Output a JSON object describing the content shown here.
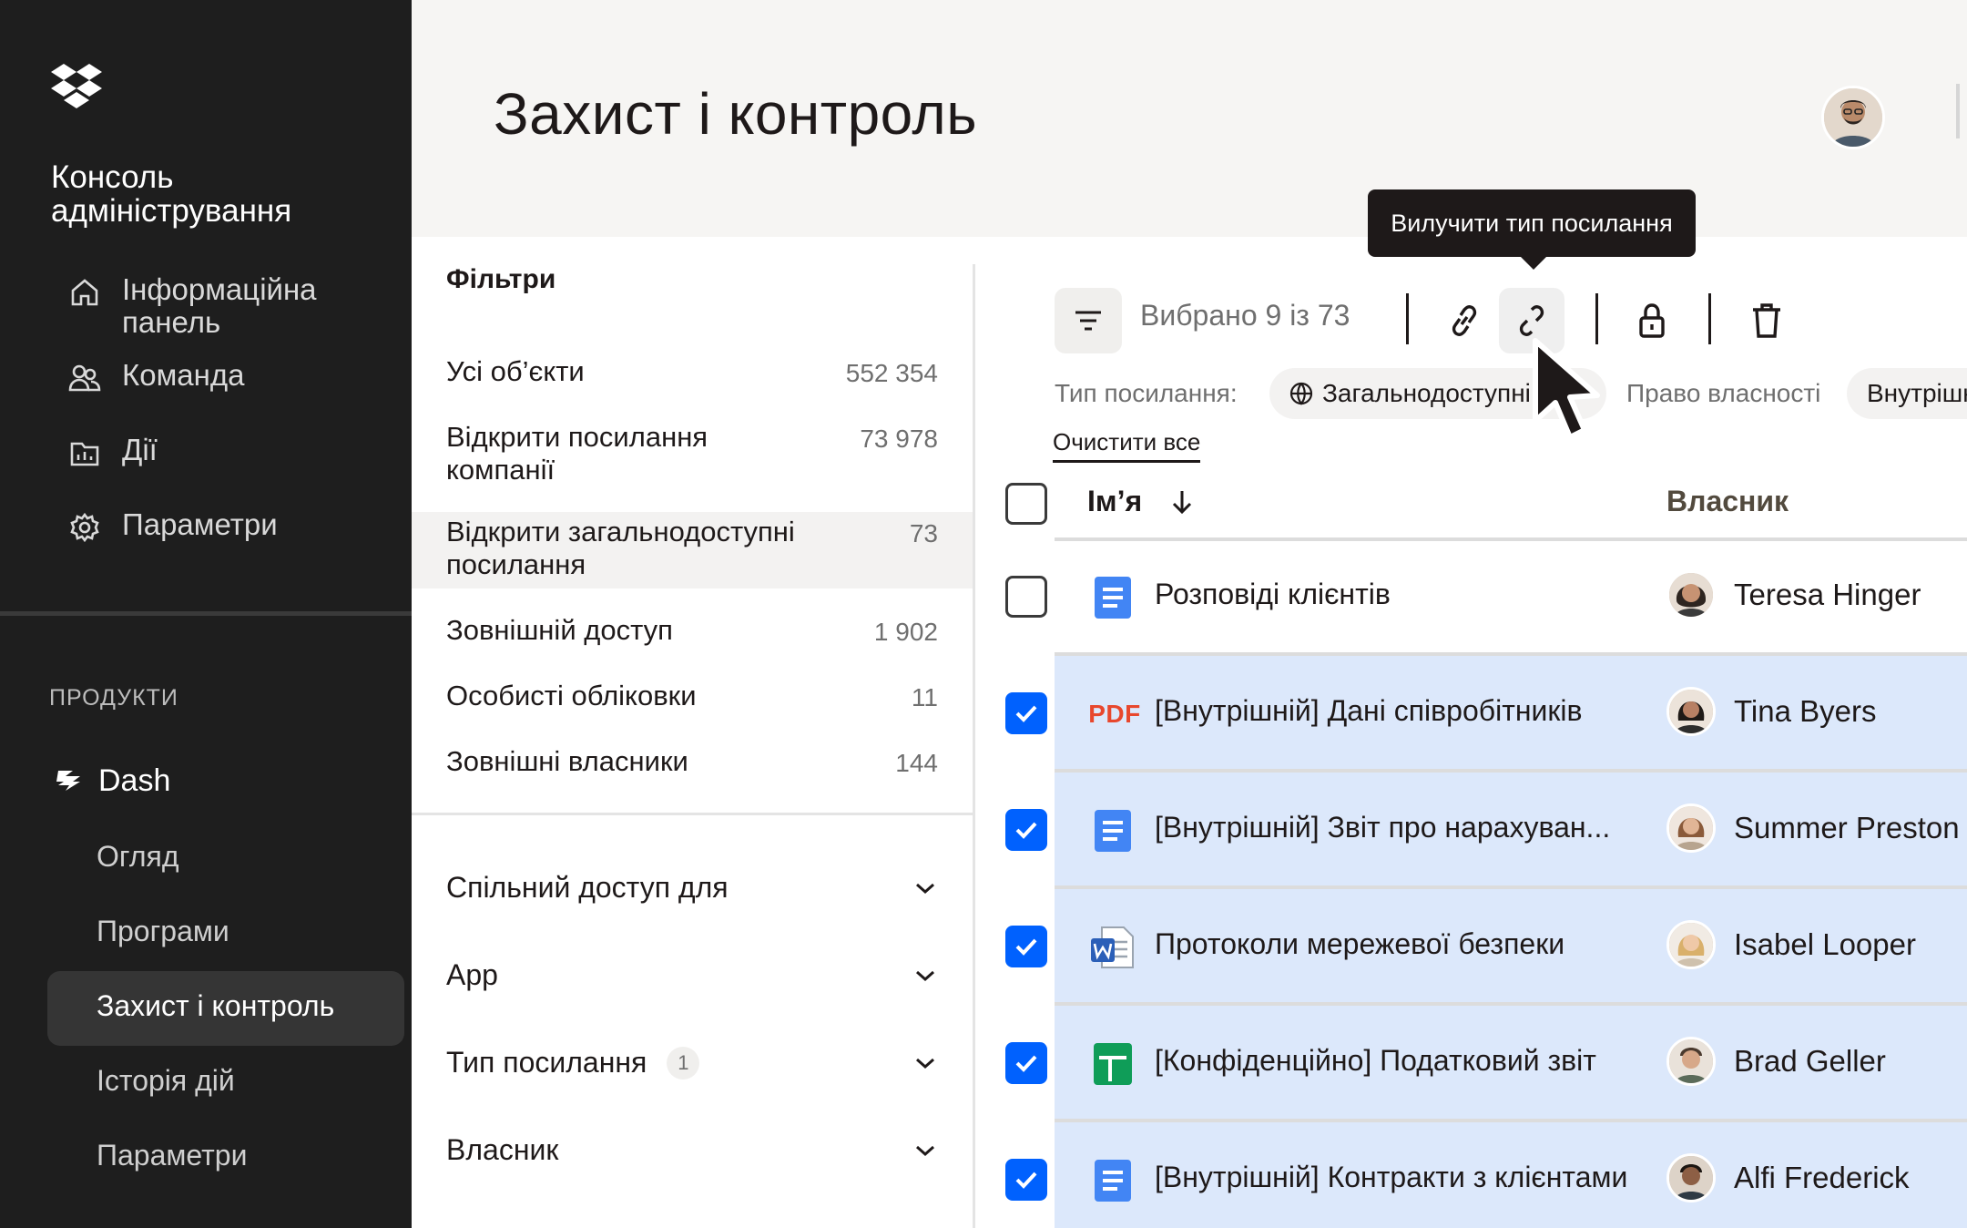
{
  "sidebar": {
    "logo": "dropbox-logo",
    "console_title": "Консоль адміністрування",
    "nav": [
      {
        "label": "Інформаційна панель",
        "icon": "home-icon"
      },
      {
        "label": "Команда",
        "icon": "team-icon"
      },
      {
        "label": "Дії",
        "icon": "activity-icon"
      },
      {
        "label": "Параметри",
        "icon": "gear-icon"
      }
    ],
    "products_label": "ПРОДУКТИ",
    "product": {
      "label": "Dash",
      "icon": "dash-icon"
    },
    "sub_items": [
      "Огляд",
      "Програми",
      "Захист і контроль",
      "Історія дій",
      "Параметри"
    ],
    "active_sub": "Захист і контроль"
  },
  "header": {
    "title": "Захист і контроль"
  },
  "filters": {
    "title": "Фільтри",
    "rows": [
      {
        "label": "Усі об’єкти",
        "count": "552 354"
      },
      {
        "label": "Відкрити посилання компанії",
        "count": "73 978"
      },
      {
        "label": "Відкрити загальнодоступні посилання",
        "count": "73"
      },
      {
        "label": "Зовнішній доступ",
        "count": "1 902"
      },
      {
        "label": "Особисті обліковки",
        "count": "11"
      },
      {
        "label": "Зовнішні власники",
        "count": "144"
      }
    ],
    "accordions": [
      {
        "label": "Спільний доступ для",
        "badge": ""
      },
      {
        "label": "App",
        "badge": ""
      },
      {
        "label": "Тип посилання",
        "badge": "1"
      },
      {
        "label": "Власник",
        "badge": ""
      }
    ]
  },
  "toolbar": {
    "selected_text": "Вибрано 9 із 73",
    "tooltip": "Вилучити тип посилання",
    "icons": [
      "link-icon",
      "unlink-icon",
      "lock-icon",
      "trash-icon"
    ]
  },
  "chips": {
    "link_type_label": "Тип посилання:",
    "link_type_value": "Загальнодоступні",
    "ownership_label": "Право власності",
    "ownership_value": "Внутрішні",
    "clear_all": "Очистити все"
  },
  "table": {
    "col_name": "Ім’я",
    "col_owner": "Власник",
    "rows": [
      {
        "name": "Розповіді клієнтів",
        "owner": "Teresa Hinger",
        "type": "doc",
        "checked": false
      },
      {
        "name": "[Внутрішній] Дані співробітників",
        "owner": "Tina Byers",
        "type": "pdf",
        "checked": true
      },
      {
        "name": "[Внутрішній] Звіт про нарахуван...",
        "owner": "Summer Preston",
        "type": "doc",
        "checked": true
      },
      {
        "name": "Протоколи мережевої безпеки",
        "owner": "Isabel Looper",
        "type": "word",
        "checked": true
      },
      {
        "name": "[Конфіденційно] Податковий звіт",
        "owner": "Brad Geller",
        "type": "sheet",
        "checked": true
      },
      {
        "name": "[Внутрішній] Контракти з клієнтами",
        "owner": "Alfi Frederick",
        "type": "doc",
        "checked": true
      }
    ],
    "pdf_label": "PDF"
  },
  "colors": {
    "sidebar_bg": "#1e1e1e",
    "accent": "#0061fe",
    "selected_row": "#dce8fb",
    "pdf": "#e8472d",
    "doc": "#4285f4",
    "sheet": "#0f9d58"
  }
}
